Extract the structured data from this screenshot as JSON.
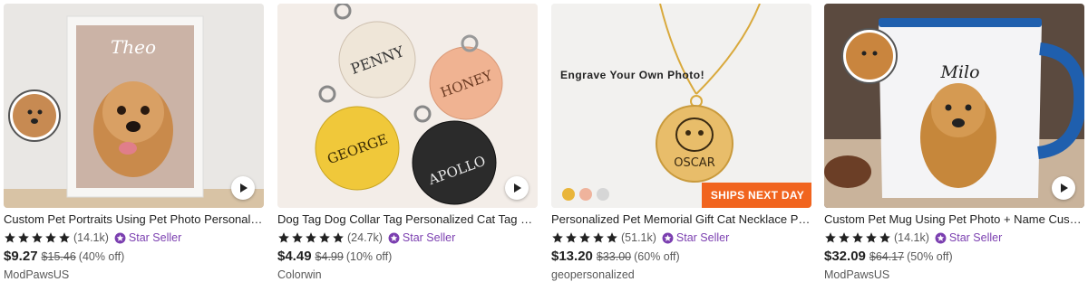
{
  "listings": [
    {
      "title": "Custom Pet Portraits Using Pet Photo Personalized Pet Lovers Gift",
      "rating_count": "(14.1k)",
      "star_seller": "Star Seller",
      "price": "$9.27",
      "original_price": "$15.46",
      "discount": "(40% off)",
      "shop": "ModPawsUS",
      "image_text": "Theo"
    },
    {
      "title": "Dog Tag Dog Collar Tag Personalized Cat Tag Custom Pet ID Tag",
      "rating_count": "(24.7k)",
      "star_seller": "Star Seller",
      "price": "$4.49",
      "original_price": "$4.99",
      "discount": "(10% off)",
      "shop": "Colorwin",
      "tag_names": [
        "PENNY",
        "HONEY",
        "GEORGE",
        "APOLLO"
      ]
    },
    {
      "title": "Personalized Pet Memorial Gift Cat Necklace Pet Portrait Pendant",
      "rating_count": "(51.1k)",
      "star_seller": "Star Seller",
      "price": "$13.20",
      "original_price": "$33.00",
      "discount": "(60% off)",
      "shop": "geopersonalized",
      "engrave_text": "Engrave Your Own Photo!",
      "pendant_name": "OSCAR",
      "ships_badge": "SHIPS NEXT DAY",
      "swatch_colors": [
        "#e9b53a",
        "#efb39c",
        "#d6d6d6"
      ]
    },
    {
      "title": "Custom Pet Mug Using Pet Photo + Name Custom Dog Mug Gift",
      "rating_count": "(14.1k)",
      "star_seller": "Star Seller",
      "price": "$32.09",
      "original_price": "$64.17",
      "discount": "(50% off)",
      "shop": "ModPawsUS",
      "image_text": "Milo"
    }
  ],
  "colors": {
    "star": "#222222",
    "star_seller": "#7b3fb0",
    "ships_badge": "#f1641e",
    "muted_text": "#595959"
  }
}
